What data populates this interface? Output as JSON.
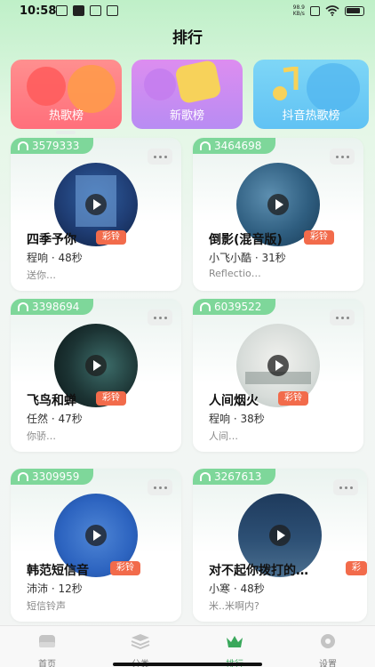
{
  "status_bar": {
    "time": "10:58",
    "speed_value": "98.9",
    "speed_unit": "KB/s"
  },
  "page": {
    "title": "排行"
  },
  "categories": [
    {
      "label": "热歌榜",
      "icon": "flame-icon",
      "color": "#ff7a84"
    },
    {
      "label": "新歌榜",
      "icon": "new-tag-icon",
      "color": "#c98cf2"
    },
    {
      "label": "抖音热歌榜",
      "icon": "music-note-icon",
      "color": "#6ccbf5"
    }
  ],
  "songs": [
    {
      "plays": "3579333",
      "title": "四季予你",
      "badge": "彩铃",
      "artist": "程响",
      "duration": "48秒",
      "desc": "送你…"
    },
    {
      "plays": "3464698",
      "title": "倒影(混音版)",
      "badge": "彩铃",
      "artist": "小飞小酷",
      "duration": "31秒",
      "desc": "Reflectio…"
    },
    {
      "plays": "3398694",
      "title": "飞鸟和蝉",
      "badge": "彩铃",
      "artist": "任然",
      "duration": "47秒",
      "desc": "你骄…"
    },
    {
      "plays": "6039522",
      "title": "人间烟火",
      "badge": "彩铃",
      "artist": "程响",
      "duration": "38秒",
      "desc": "人间…"
    },
    {
      "plays": "3309959",
      "title": "韩范短信音",
      "badge": "彩铃",
      "artist": "沛沛",
      "duration": "12秒",
      "desc": "短信铃声"
    },
    {
      "plays": "3267613",
      "title": "对不起你拨打的…",
      "badge": "彩铃",
      "artist": "小寒",
      "duration": "48秒",
      "desc": "米..米啊内?"
    }
  ],
  "meta_separator": "·",
  "bottom_nav": [
    {
      "label": "首页",
      "icon": "home-icon",
      "active": false
    },
    {
      "label": "分类",
      "icon": "layers-icon",
      "active": false
    },
    {
      "label": "排行",
      "icon": "crown-icon",
      "active": true
    },
    {
      "label": "设置",
      "icon": "gear-icon",
      "active": false
    }
  ],
  "colors": {
    "accent": "#3aa85c",
    "play_badge": "#7ed79a",
    "ringtone_badge": "#f26b4b"
  }
}
